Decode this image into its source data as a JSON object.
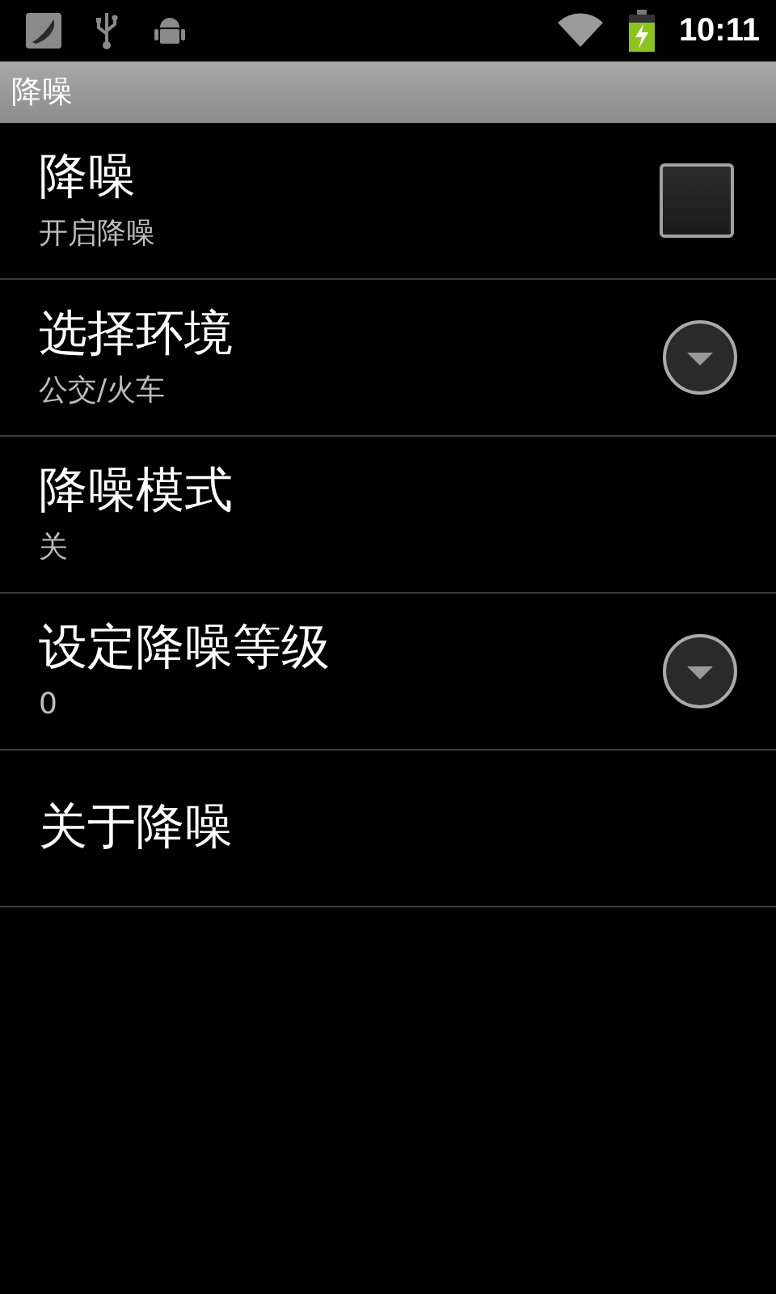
{
  "status_bar": {
    "time": "10:11"
  },
  "title_bar": {
    "title": "降噪"
  },
  "preferences": [
    {
      "kind": "checkbox",
      "title": "降噪",
      "summary": "开启降噪",
      "checked": false
    },
    {
      "kind": "dropdown",
      "title": "选择环境",
      "summary": "公交/火车"
    },
    {
      "kind": "plain",
      "title": "降噪模式",
      "summary": "关"
    },
    {
      "kind": "dropdown",
      "title": "设定降噪等级",
      "summary": "0"
    },
    {
      "kind": "plain",
      "title": "关于降噪"
    }
  ]
}
